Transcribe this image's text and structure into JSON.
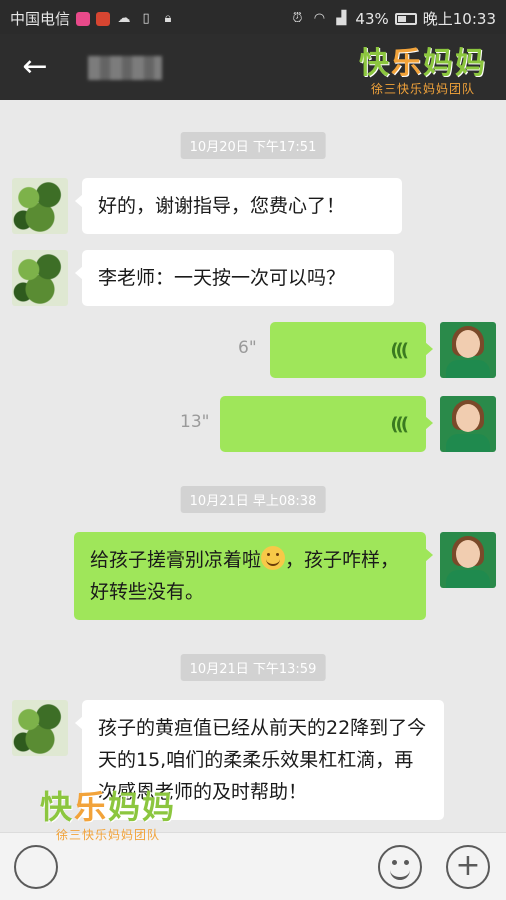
{
  "status_bar": {
    "carrier": "中国电信",
    "battery": "43%",
    "battery_level": 0.43,
    "time": "晚上10:33"
  },
  "header": {
    "back_icon": "arrow-left-icon"
  },
  "watermark": {
    "title_a": "快",
    "title_b": "乐",
    "title_c": "妈妈",
    "subtitle": "徐三快乐妈妈团队"
  },
  "timestamps": [
    "10月20日 下午17:51",
    "10月21日 早上08:38",
    "10月21日 下午13:59"
  ],
  "messages": [
    {
      "side": "left",
      "text": "好的，谢谢指导，您费心了！"
    },
    {
      "side": "left",
      "text": "李老师：一天按一次可以吗？"
    },
    {
      "side": "right",
      "type": "voice",
      "duration": "6\""
    },
    {
      "side": "right",
      "type": "voice",
      "duration": "13\""
    },
    {
      "side": "right",
      "text_before": "给孩子搓膏别凉着啦",
      "text_after": "，孩子咋样，好转些没有。"
    },
    {
      "side": "left",
      "text": "孩子的黄疸值已经从前天的22降到了今天的15,咱们的柔柔乐效果杠杠滴，再次感恩老师的及时帮助！"
    }
  ],
  "input_bar": {
    "voice_icon": "voice-toggle-icon",
    "emoji_icon": "smiley-icon",
    "plus_icon": "plus-icon"
  }
}
